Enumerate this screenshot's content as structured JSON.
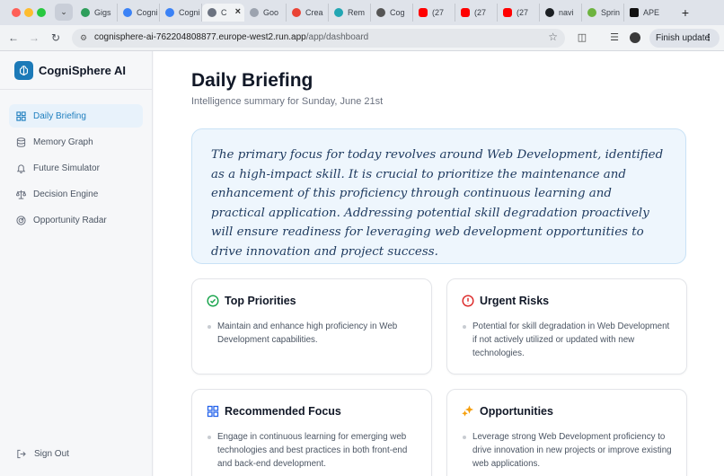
{
  "browser": {
    "tabs": [
      {
        "title": "Gigs",
        "color": "#2e9e5b"
      },
      {
        "title": "Cogni",
        "color": "#3b82f6"
      },
      {
        "title": "Cogni",
        "color": "#3b82f6"
      },
      {
        "title": "C",
        "color": "#6b7280",
        "active": true
      },
      {
        "title": "Goo",
        "color": "#9ca3af"
      },
      {
        "title": "Crea",
        "color": "#ea4335"
      },
      {
        "title": "Rem",
        "color": "#22a6b3"
      },
      {
        "title": "Cog",
        "color": "#555555"
      },
      {
        "title": "(27",
        "color": "#ff0000"
      },
      {
        "title": "(27",
        "color": "#ff0000"
      },
      {
        "title": "(27",
        "color": "#ff0000"
      },
      {
        "title": "navi",
        "color": "#1b1f23"
      },
      {
        "title": "Sprin",
        "color": "#6db33f"
      },
      {
        "title": "APE",
        "color": "#111111"
      }
    ],
    "url_host": "cognisphere-ai-762204808877.europe-west2.run.app",
    "url_path": "/app/dashboard",
    "finish_update_label": "Finish update"
  },
  "app": {
    "brand": "CogniSphere AI",
    "accent_color": "#1c7ab8",
    "nav": [
      {
        "label": "Daily Briefing",
        "icon": "grid-icon",
        "active": true
      },
      {
        "label": "Memory Graph",
        "icon": "database-icon"
      },
      {
        "label": "Future Simulator",
        "icon": "bell-icon"
      },
      {
        "label": "Decision Engine",
        "icon": "scale-icon"
      },
      {
        "label": "Opportunity Radar",
        "icon": "radar-icon"
      }
    ],
    "sign_out_label": "Sign Out"
  },
  "page": {
    "title": "Daily Briefing",
    "subtitle": "Intelligence summary for Sunday, June 21st",
    "summary": "The primary focus for today revolves around Web Development, identified as a high-impact skill. It is crucial to prioritize the maintenance and enhancement of this proficiency through continuous learning and practical application. Addressing potential skill degradation proactively will ensure readiness for leveraging web development opportunities to drive innovation and project success.",
    "cards": {
      "priorities": {
        "title": "Top Priorities",
        "icon": "check-circle-icon",
        "icon_color": "#16a34a",
        "items": [
          "Maintain and enhance high proficiency in Web Development capabilities."
        ]
      },
      "risks": {
        "title": "Urgent Risks",
        "icon": "alert-circle-icon",
        "icon_color": "#dc2626",
        "items": [
          "Potential for skill degradation in Web Development if not actively utilized or updated with new technologies."
        ]
      },
      "focus": {
        "title": "Recommended Focus",
        "icon": "grid-icon",
        "icon_color": "#2563eb",
        "items": [
          "Engage in continuous learning for emerging web technologies and best practices in both front-end and back-end development."
        ]
      },
      "opportunities": {
        "title": "Opportunities",
        "icon": "sparkles-icon",
        "icon_color": "#f59e0b",
        "items": [
          "Leverage strong Web Development proficiency to drive innovation in new projects or improve existing web applications."
        ]
      }
    }
  }
}
